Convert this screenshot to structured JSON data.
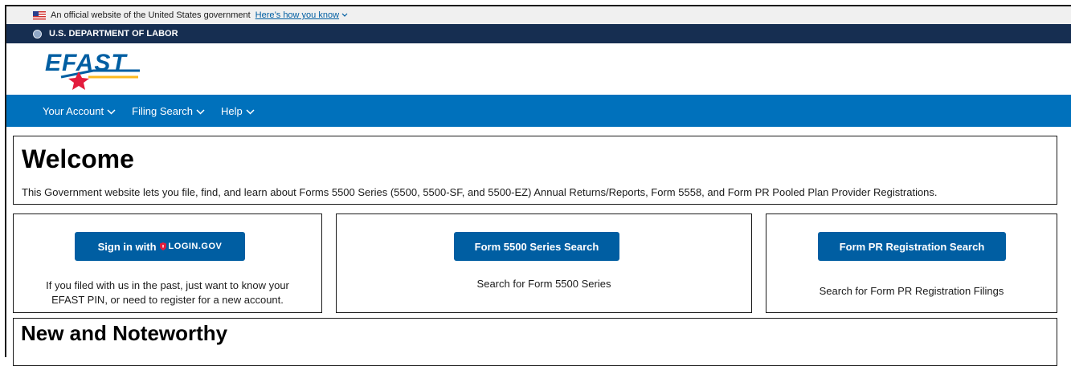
{
  "gov_banner": {
    "text": "An official website of the United States government",
    "link": "Here’s how you know"
  },
  "agency_bar": {
    "label": "U.S. DEPARTMENT OF LABOR"
  },
  "logo": {
    "text": "EFAST"
  },
  "nav": {
    "items": [
      {
        "label": "Your Account"
      },
      {
        "label": "Filing Search"
      },
      {
        "label": "Help"
      }
    ]
  },
  "welcome": {
    "title": "Welcome",
    "description": "This Government website lets you file, find, and learn about Forms 5500 Series (5500, 5500-SF, and 5500-EZ) Annual Returns/Reports, Form 5558, and Form PR Pooled Plan Provider Registrations."
  },
  "cards": {
    "login": {
      "button_prefix": "Sign in with",
      "button_brand": "LOGIN.GOV",
      "line1": "If you filed with us in the past, just want to know your",
      "line2": "EFAST PIN, or need to register for a new account."
    },
    "form5500": {
      "button": "Form 5500 Series Search",
      "text": "Search for Form 5500 Series"
    },
    "formpr": {
      "button": "Form PR Registration Search",
      "text": "Search for Form PR Registration Filings"
    }
  },
  "news": {
    "title": "New and Noteworthy"
  },
  "colors": {
    "nav_blue": "#0071bc",
    "agency_navy": "#162e51",
    "button_blue": "#005ea2",
    "logo_red": "#e31c3d",
    "logo_yellow": "#fdb81e"
  }
}
